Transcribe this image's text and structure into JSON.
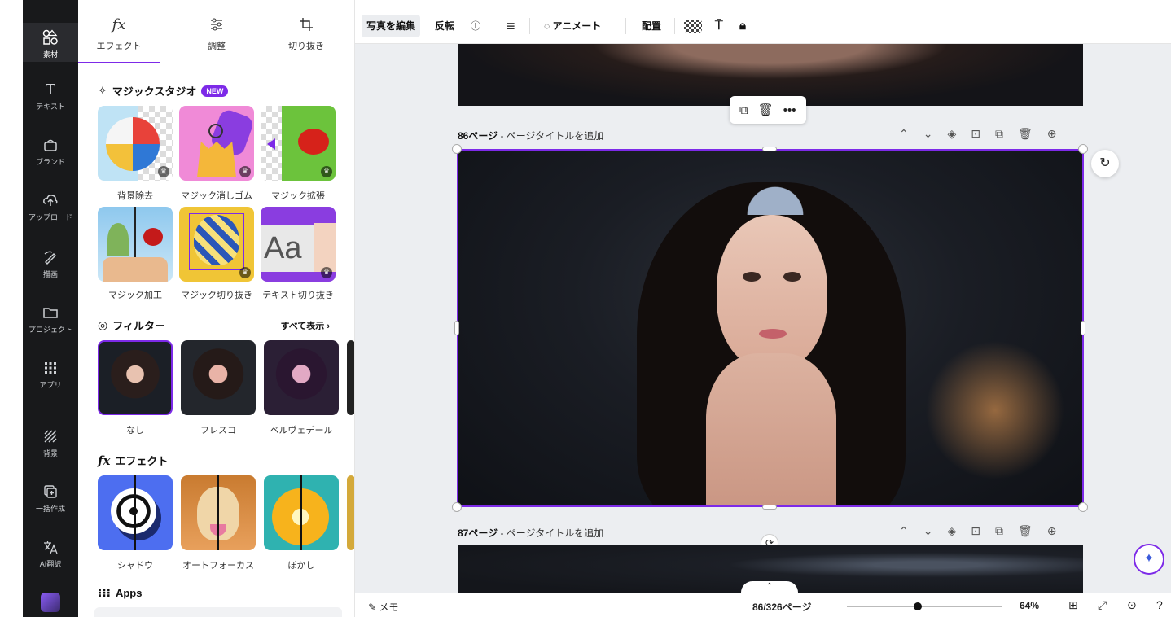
{
  "rail": {
    "items": [
      {
        "label": "素材",
        "icon": "elements-icon"
      },
      {
        "label": "テキスト",
        "icon": "text-icon"
      },
      {
        "label": "ブランド",
        "icon": "brand-icon"
      },
      {
        "label": "アップロード",
        "icon": "upload-icon"
      },
      {
        "label": "描画",
        "icon": "draw-icon"
      },
      {
        "label": "プロジェクト",
        "icon": "folder-icon"
      },
      {
        "label": "アプリ",
        "icon": "apps-grid-icon"
      },
      {
        "label": "背景",
        "icon": "background-icon"
      },
      {
        "label": "一括作成",
        "icon": "bulk-create-icon"
      },
      {
        "label": "AI翻訳",
        "icon": "translate-icon"
      }
    ]
  },
  "panel": {
    "tabs": [
      {
        "label": "エフェクト",
        "icon": "fx"
      },
      {
        "label": "調整",
        "icon": "adjust-sliders-icon"
      },
      {
        "label": "切り抜き",
        "icon": "crop-icon"
      }
    ],
    "magic_studio": {
      "title": "マジックスタジオ",
      "badge": "NEW",
      "tools": [
        "背景除去",
        "マジック消しゴム",
        "マジック拡張",
        "マジック加工",
        "マジック切り抜き",
        "テキスト切り抜き"
      ]
    },
    "filters": {
      "title": "フィルター",
      "see_all": "すべて表示 ›",
      "items": [
        "なし",
        "フレスコ",
        "ベルヴェデール"
      ]
    },
    "effects": {
      "title": "エフェクト",
      "items": [
        "シャドウ",
        "オートフォーカス",
        "ぼかし"
      ]
    },
    "apps": {
      "title": "Apps"
    }
  },
  "toolbar": {
    "edit_photo": "写真を編集",
    "flip": "反転",
    "animate": "アニメート",
    "position": "配置"
  },
  "canvas": {
    "page86": {
      "number": "86ページ",
      "title_placeholder": " - ページタイトルを追加"
    },
    "page87": {
      "number": "87ページ",
      "title_placeholder": " - ページタイトルを追加"
    }
  },
  "bottombar": {
    "notes": "メモ",
    "page_counter": "86/326ページ",
    "zoom": "64%",
    "zoom_fraction": 0.46
  },
  "colors": {
    "accent": "#7d2ae8",
    "rail_bg": "#18191b",
    "canvas_bg": "#eceef1"
  }
}
